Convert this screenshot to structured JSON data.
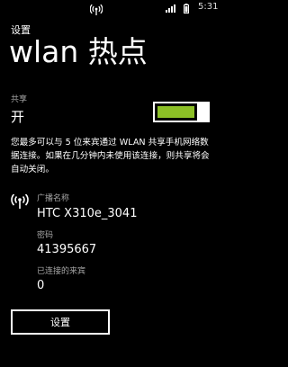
{
  "status_bar": {
    "time": "5:31",
    "icons": [
      "wifi-hotspot-icon",
      "signal-icon",
      "battery-icon"
    ]
  },
  "app_title": "设置",
  "page_title": "wlan 热点",
  "sharing": {
    "label": "共享",
    "state": "开",
    "enabled": true,
    "accent_color": "#8cbf26"
  },
  "description": "您最多可以与 5 位来宾通过 WLAN 共享手机网络数据连接。如果在几分钟内未使用该连接，则共享将会自动关闭。",
  "broadcast_name": {
    "label": "广播名称",
    "value": "HTC X310e_3041"
  },
  "password": {
    "label": "密码",
    "value": "41395667"
  },
  "connected_guests": {
    "label": "已连接的来宾",
    "value": "0"
  },
  "settings_button": "设置"
}
